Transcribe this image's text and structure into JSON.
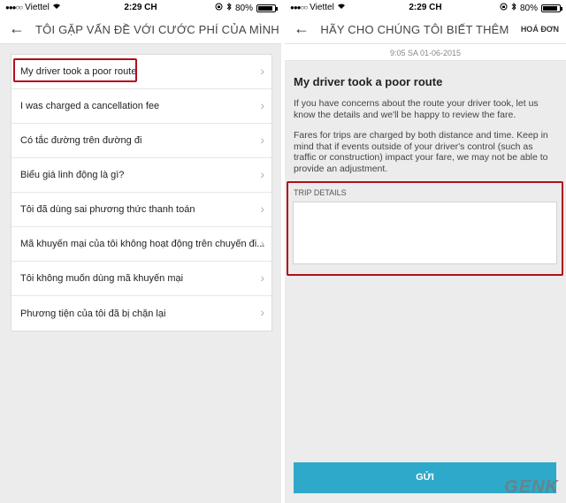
{
  "status_bar": {
    "signal_dots": "●●●○○",
    "carrier": "Viettel",
    "time": "2:29 CH",
    "battery": "80%"
  },
  "left_screen": {
    "title": "TÔI GẶP VẤN ĐỀ VỚI CƯỚC PHÍ CỦA MÌNH",
    "items": [
      {
        "label": "My driver took a poor route"
      },
      {
        "label": "I was charged a cancellation fee"
      },
      {
        "label": "Có tắc đường trên đường đi"
      },
      {
        "label": "Biểu giá linh động là gì?"
      },
      {
        "label": "Tôi đã dùng sai phương thức thanh toán"
      },
      {
        "label": "Mã khuyến mại của tôi không hoạt động trên chuyến đi..."
      },
      {
        "label": "Tôi không muốn dùng mã khuyến mại"
      },
      {
        "label": "Phương tiện của tôi đã bị chặn lại"
      }
    ]
  },
  "right_screen": {
    "title": "HÃY CHO CHÚNG TÔI BIẾT THÊM",
    "done_label": "HOÁ ĐƠN",
    "date": "9:05 SA 01-06-2015",
    "heading": "My driver took a poor route",
    "paragraph1": "If you have concerns about the route your driver took, let us know the details and we'll be happy to review the fare.",
    "paragraph2": "Fares for trips are charged by both distance and time. Keep in mind that if events outside of your driver's control (such as traffic or construction) impact your fare, we may not be able to provide an adjustment.",
    "trip_details_label": "TRIP DETAILS",
    "trip_details_value": "",
    "submit_label": "GỬI"
  },
  "watermark": "GENK",
  "colors": {
    "accent": "#2ea9c9",
    "highlight": "#b0101a"
  }
}
